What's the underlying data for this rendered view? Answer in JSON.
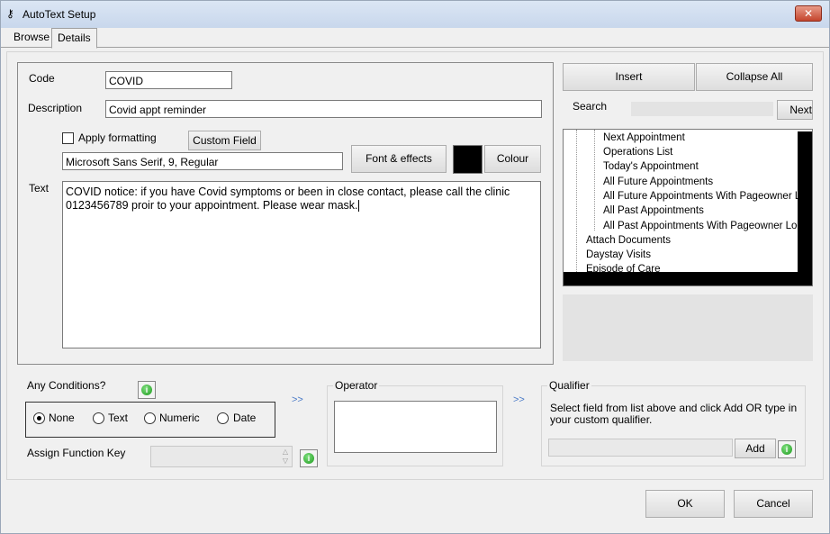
{
  "window": {
    "title": "AutoText Setup",
    "close_label": "✕",
    "app_icon": "key-icon"
  },
  "tabs": [
    {
      "label": "Browse",
      "active": false
    },
    {
      "label": "Details",
      "active": true
    }
  ],
  "form": {
    "code_label": "Code",
    "code_value": "COVID",
    "description_label": "Description",
    "description_value": "Covid appt reminder",
    "apply_formatting_label": "Apply formatting",
    "custom_field_button": "Custom Field",
    "font_value": "Microsoft Sans Serif, 9, Regular",
    "font_effects_button": "Font & effects",
    "colour_swatch": "#000000",
    "colour_button": "Colour",
    "text_label": "Text",
    "text_line1": "COVID notice: if you have Covid symptoms or been in close contact, please call the clinic",
    "text_line2": "0123456789 proir to your appointment. Please wear mask."
  },
  "right_panel": {
    "insert_button": "Insert",
    "collapse_all_button": "Collapse All",
    "search_label": "Search",
    "search_value": "",
    "next_button": "Next",
    "tree_items": [
      "Next Appointment",
      "Operations List",
      "Today's Appointment",
      "All Future Appointments",
      "All Future Appointments With Pageowner Lo",
      "All Past Appointments",
      "All Past Appointments With Pageowner Loca",
      "Attach Documents",
      "Daystay Visits",
      "Episode of Care"
    ]
  },
  "conditions": {
    "label": "Any Conditions?",
    "options": [
      "None",
      "Text",
      "Numeric",
      "Date"
    ],
    "selected": "None",
    "assign_key_label": "Assign Function Key",
    "arrow": ">>"
  },
  "operator": {
    "label": "Operator"
  },
  "qualifier": {
    "label": "Qualifier",
    "hint_line1": "Select field from list above and click Add OR type in",
    "hint_line2": "your custom qualifier.",
    "add_button": "Add",
    "arrow": ">>"
  },
  "footer": {
    "ok_button": "OK",
    "cancel_button": "Cancel"
  },
  "info_icon_glyph": "i"
}
